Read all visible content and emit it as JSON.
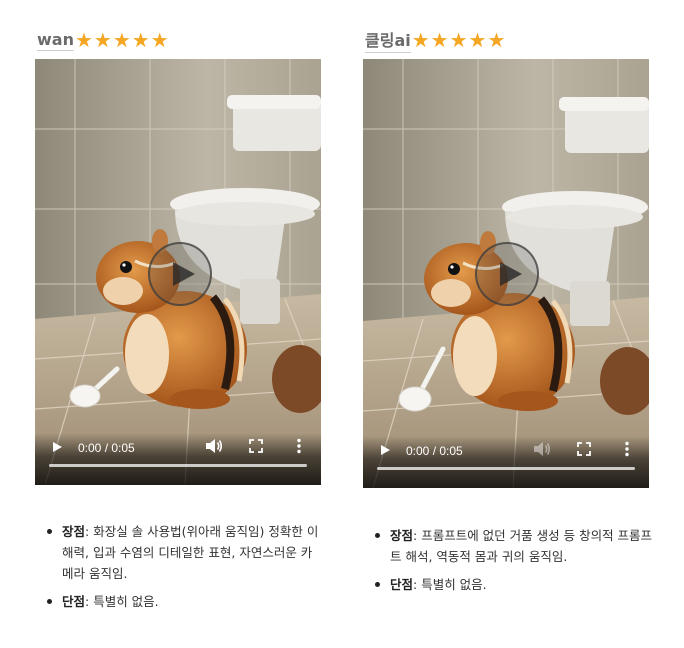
{
  "panels": [
    {
      "name": "wan",
      "stars": "★★★★★",
      "video": {
        "time": "0:00 / 0:05"
      },
      "notes": [
        {
          "label": "장점",
          "text": ": 화장실 솔 사용법(위아래 움직임) 정확한 이해력, 입과 수염의 디테일한 표현, 자연스러운 카메라 움직임."
        },
        {
          "label": "단점",
          "text": ": 특별히 없음."
        }
      ]
    },
    {
      "name": "클링ai",
      "stars": "★★★★★",
      "video": {
        "time": "0:00 / 0:05"
      },
      "notes": [
        {
          "label": "장점",
          "text": ": 프롬프트에 없던 거품 생성 등 창의적 프롬프트 해석, 역동적 몸과 귀의 움직임."
        },
        {
          "label": "단점",
          "text": ": 특별히 없음."
        }
      ]
    }
  ],
  "colors": {
    "star": "#f5a623",
    "title": "#6b6b6b",
    "text": "#333333"
  },
  "icons": [
    "play-icon",
    "volume-icon",
    "fullscreen-icon",
    "more-options-icon"
  ]
}
